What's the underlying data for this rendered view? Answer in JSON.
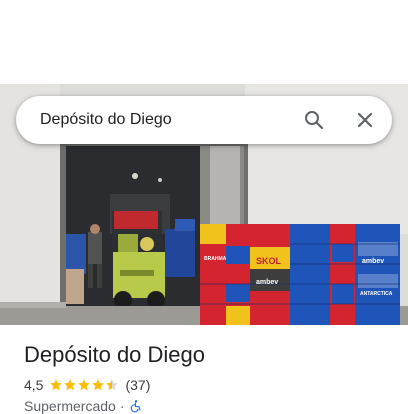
{
  "search": {
    "query": "Depósito do Diego"
  },
  "place": {
    "name": "Depósito do Diego",
    "rating": "4,5",
    "rating_stars": 4.5,
    "review_count": "(37)",
    "category": "Supermercado",
    "separator": "·"
  },
  "photo_signage": {
    "brahma": "BRAHMA",
    "skol": "SKOL",
    "ambev": "ambev",
    "antarctica": "ANTARCTICA"
  },
  "colors": {
    "star": "#fbbc04",
    "accessibility": "#1a73e8",
    "crate_red": "#d3242f",
    "crate_blue": "#1f55b8",
    "crate_yellow": "#f1c21b"
  },
  "icons": [
    "search-icon",
    "close-icon",
    "star-icon",
    "wheelchair-icon"
  ]
}
